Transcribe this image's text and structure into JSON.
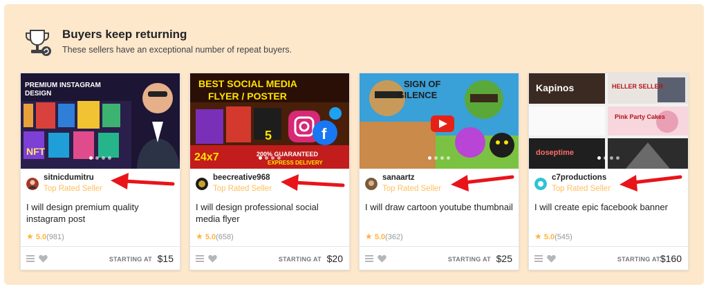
{
  "section": {
    "title": "Buyers keep returning",
    "subtitle": "These sellers have an exceptional number of repeat buyers."
  },
  "cards": [
    {
      "thumb_text": [
        "PREMIUM INSTAGRAM",
        "DESIGN",
        "NFT"
      ],
      "seller": "sitnicdumitru",
      "level": "Top Rated Seller",
      "title": "I will design premium quality instagram post",
      "rating": "5.0",
      "reviews": "(981)",
      "starting": "STARTING AT",
      "price": "$15"
    },
    {
      "thumb_text": [
        "BEST SOCIAL MEDIA",
        "FLYER / POSTER",
        "24x7",
        "200% GUARANTEED",
        "EXPRESS DELIVERY",
        "5"
      ],
      "seller": "beecreative968",
      "level": "Top Rated Seller",
      "title": "I will design professional social media flyer",
      "rating": "5.0",
      "reviews": "(658)",
      "starting": "STARTING AT",
      "price": "$20"
    },
    {
      "thumb_text": [
        "SIGN OF",
        "SILENCE"
      ],
      "seller": "sanaartz",
      "level": "Top Rated Seller",
      "title": "I will draw cartoon youtube thumbnail",
      "rating": "5.0",
      "reviews": "(362)",
      "starting": "STARTING AT",
      "price": "$25"
    },
    {
      "thumb_text": [
        "Kapinos",
        "HELLER SELLER",
        "Pink Party Cakes",
        "doseptime"
      ],
      "seller": "c7productions",
      "level": "Top Rated Seller",
      "title": "I will create epic facebook banner",
      "rating": "5.0",
      "reviews": "(545)",
      "starting": "STARTING AT",
      "price": "$160"
    }
  ],
  "colors": {
    "background": "#fde8cc",
    "level": "#ffbe5b",
    "star": "#ffb33e",
    "annotation_arrow": "#e8141a"
  },
  "icons": [
    "trophy-icon",
    "star-icon",
    "collections-icon",
    "heart-icon",
    "play-icon",
    "instagram-icon",
    "facebook-icon"
  ]
}
